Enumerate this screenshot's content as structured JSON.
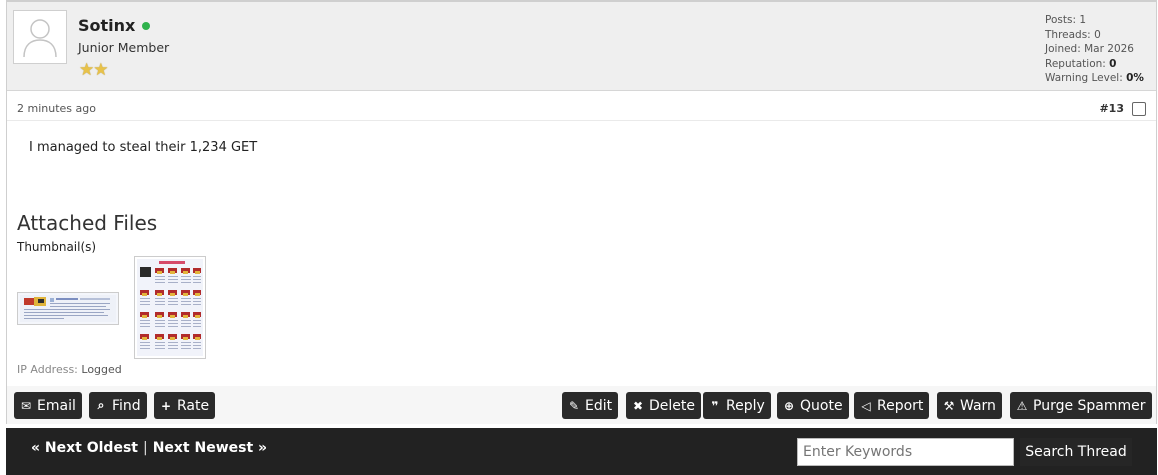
{
  "author": {
    "username": "Sotinx",
    "user_title": "Junior Member",
    "stars": "★★",
    "online_status_color": "#2fb24c",
    "stats": {
      "posts_label": "Posts:",
      "posts": "1",
      "threads_label": "Threads:",
      "threads": "0",
      "joined_label": "Joined:",
      "joined": "Mar 2026",
      "reputation_label": "Reputation:",
      "reputation": "0",
      "warning_label": "Warning Level:",
      "warning": "0%"
    }
  },
  "post": {
    "date": "2 minutes ago",
    "number": "#13",
    "message": "I managed to steal their 1,234 GET",
    "attachments_title": "Attached Files",
    "thumbnails_label": "Thumbnail(s)",
    "ip_label": "IP Address:",
    "ip_value": "Logged"
  },
  "buttons": {
    "email": "Email",
    "find": "Find",
    "rate": "Rate",
    "edit": "Edit",
    "delete": "Delete",
    "reply": "Reply",
    "quote": "Quote",
    "report": "Report",
    "warn": "Warn",
    "purge": "Purge Spammer"
  },
  "footer": {
    "next_oldest": "« Next Oldest",
    "separator": "|",
    "next_newest": "Next Newest »",
    "search_placeholder": "Enter Keywords",
    "search_button": "Search Thread"
  },
  "colors": {
    "button_bg": "#2a2a2a",
    "footer_bg": "#222222",
    "star": "#e8c24a"
  }
}
